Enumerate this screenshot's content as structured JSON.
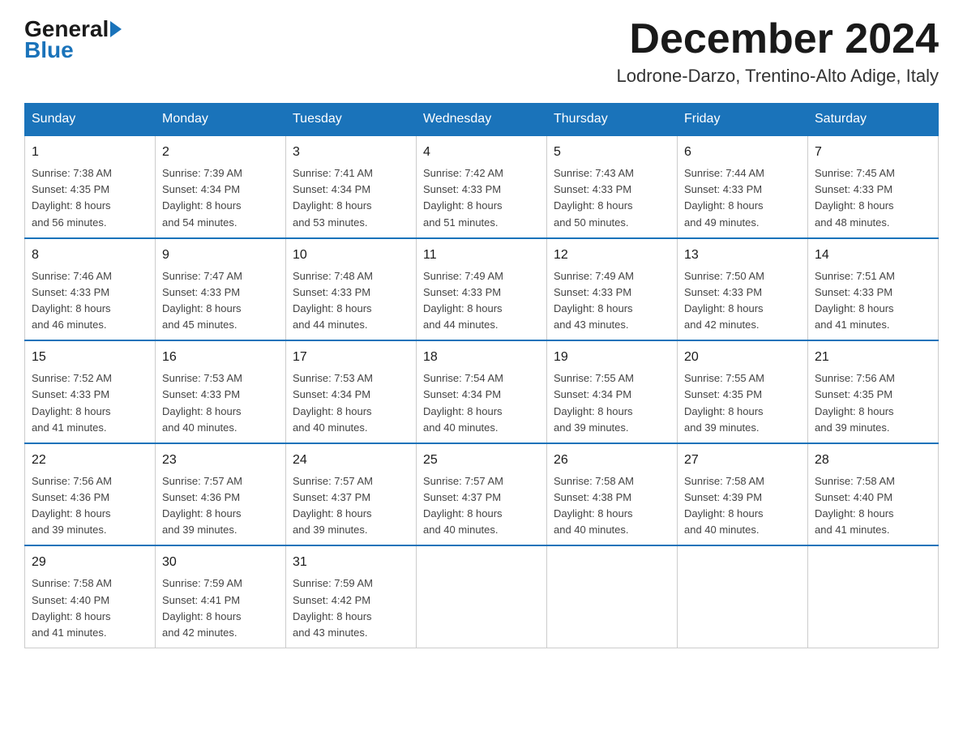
{
  "logo": {
    "general": "General",
    "blue": "Blue"
  },
  "title": {
    "month": "December 2024",
    "location": "Lodrone-Darzo, Trentino-Alto Adige, Italy"
  },
  "headers": [
    "Sunday",
    "Monday",
    "Tuesday",
    "Wednesday",
    "Thursday",
    "Friday",
    "Saturday"
  ],
  "weeks": [
    [
      {
        "day": "1",
        "info": "Sunrise: 7:38 AM\nSunset: 4:35 PM\nDaylight: 8 hours\nand 56 minutes."
      },
      {
        "day": "2",
        "info": "Sunrise: 7:39 AM\nSunset: 4:34 PM\nDaylight: 8 hours\nand 54 minutes."
      },
      {
        "day": "3",
        "info": "Sunrise: 7:41 AM\nSunset: 4:34 PM\nDaylight: 8 hours\nand 53 minutes."
      },
      {
        "day": "4",
        "info": "Sunrise: 7:42 AM\nSunset: 4:33 PM\nDaylight: 8 hours\nand 51 minutes."
      },
      {
        "day": "5",
        "info": "Sunrise: 7:43 AM\nSunset: 4:33 PM\nDaylight: 8 hours\nand 50 minutes."
      },
      {
        "day": "6",
        "info": "Sunrise: 7:44 AM\nSunset: 4:33 PM\nDaylight: 8 hours\nand 49 minutes."
      },
      {
        "day": "7",
        "info": "Sunrise: 7:45 AM\nSunset: 4:33 PM\nDaylight: 8 hours\nand 48 minutes."
      }
    ],
    [
      {
        "day": "8",
        "info": "Sunrise: 7:46 AM\nSunset: 4:33 PM\nDaylight: 8 hours\nand 46 minutes."
      },
      {
        "day": "9",
        "info": "Sunrise: 7:47 AM\nSunset: 4:33 PM\nDaylight: 8 hours\nand 45 minutes."
      },
      {
        "day": "10",
        "info": "Sunrise: 7:48 AM\nSunset: 4:33 PM\nDaylight: 8 hours\nand 44 minutes."
      },
      {
        "day": "11",
        "info": "Sunrise: 7:49 AM\nSunset: 4:33 PM\nDaylight: 8 hours\nand 44 minutes."
      },
      {
        "day": "12",
        "info": "Sunrise: 7:49 AM\nSunset: 4:33 PM\nDaylight: 8 hours\nand 43 minutes."
      },
      {
        "day": "13",
        "info": "Sunrise: 7:50 AM\nSunset: 4:33 PM\nDaylight: 8 hours\nand 42 minutes."
      },
      {
        "day": "14",
        "info": "Sunrise: 7:51 AM\nSunset: 4:33 PM\nDaylight: 8 hours\nand 41 minutes."
      }
    ],
    [
      {
        "day": "15",
        "info": "Sunrise: 7:52 AM\nSunset: 4:33 PM\nDaylight: 8 hours\nand 41 minutes."
      },
      {
        "day": "16",
        "info": "Sunrise: 7:53 AM\nSunset: 4:33 PM\nDaylight: 8 hours\nand 40 minutes."
      },
      {
        "day": "17",
        "info": "Sunrise: 7:53 AM\nSunset: 4:34 PM\nDaylight: 8 hours\nand 40 minutes."
      },
      {
        "day": "18",
        "info": "Sunrise: 7:54 AM\nSunset: 4:34 PM\nDaylight: 8 hours\nand 40 minutes."
      },
      {
        "day": "19",
        "info": "Sunrise: 7:55 AM\nSunset: 4:34 PM\nDaylight: 8 hours\nand 39 minutes."
      },
      {
        "day": "20",
        "info": "Sunrise: 7:55 AM\nSunset: 4:35 PM\nDaylight: 8 hours\nand 39 minutes."
      },
      {
        "day": "21",
        "info": "Sunrise: 7:56 AM\nSunset: 4:35 PM\nDaylight: 8 hours\nand 39 minutes."
      }
    ],
    [
      {
        "day": "22",
        "info": "Sunrise: 7:56 AM\nSunset: 4:36 PM\nDaylight: 8 hours\nand 39 minutes."
      },
      {
        "day": "23",
        "info": "Sunrise: 7:57 AM\nSunset: 4:36 PM\nDaylight: 8 hours\nand 39 minutes."
      },
      {
        "day": "24",
        "info": "Sunrise: 7:57 AM\nSunset: 4:37 PM\nDaylight: 8 hours\nand 39 minutes."
      },
      {
        "day": "25",
        "info": "Sunrise: 7:57 AM\nSunset: 4:37 PM\nDaylight: 8 hours\nand 40 minutes."
      },
      {
        "day": "26",
        "info": "Sunrise: 7:58 AM\nSunset: 4:38 PM\nDaylight: 8 hours\nand 40 minutes."
      },
      {
        "day": "27",
        "info": "Sunrise: 7:58 AM\nSunset: 4:39 PM\nDaylight: 8 hours\nand 40 minutes."
      },
      {
        "day": "28",
        "info": "Sunrise: 7:58 AM\nSunset: 4:40 PM\nDaylight: 8 hours\nand 41 minutes."
      }
    ],
    [
      {
        "day": "29",
        "info": "Sunrise: 7:58 AM\nSunset: 4:40 PM\nDaylight: 8 hours\nand 41 minutes."
      },
      {
        "day": "30",
        "info": "Sunrise: 7:59 AM\nSunset: 4:41 PM\nDaylight: 8 hours\nand 42 minutes."
      },
      {
        "day": "31",
        "info": "Sunrise: 7:59 AM\nSunset: 4:42 PM\nDaylight: 8 hours\nand 43 minutes."
      },
      {
        "day": "",
        "info": ""
      },
      {
        "day": "",
        "info": ""
      },
      {
        "day": "",
        "info": ""
      },
      {
        "day": "",
        "info": ""
      }
    ]
  ]
}
